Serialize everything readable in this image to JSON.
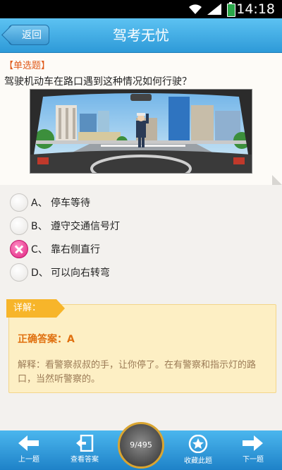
{
  "statusbar": {
    "time": "14:18"
  },
  "header": {
    "back_label": "返回",
    "title": "驾考无忧"
  },
  "question": {
    "type_label": "【单选题】",
    "text": "驾驶机动车在路口遇到这种情况如何行驶？"
  },
  "options": [
    {
      "letter": "A、",
      "text": "停车等待",
      "state": "normal"
    },
    {
      "letter": "B、",
      "text": "遵守交通信号灯",
      "state": "normal"
    },
    {
      "letter": "C、",
      "text": "靠右侧直行",
      "state": "wrong"
    },
    {
      "letter": "D、",
      "text": "可以向右转弯",
      "state": "normal"
    }
  ],
  "explanation": {
    "tag": "详解：",
    "answer": "正确答案：A",
    "analysis": "解释：看警察叔叔的手，让你停了。在有警察和指示灯的路口，当然听警察的。"
  },
  "bottom_nav": {
    "prev": "上一题",
    "view_answer": "查看答案",
    "progress": "9/495",
    "favorite": "收藏此题",
    "next": "下一题"
  },
  "colors": {
    "accent_blue": "#2e9ad8",
    "question_type": "#e05a1a",
    "answer": "#e07010",
    "wrong_mark": "#e0207f"
  }
}
